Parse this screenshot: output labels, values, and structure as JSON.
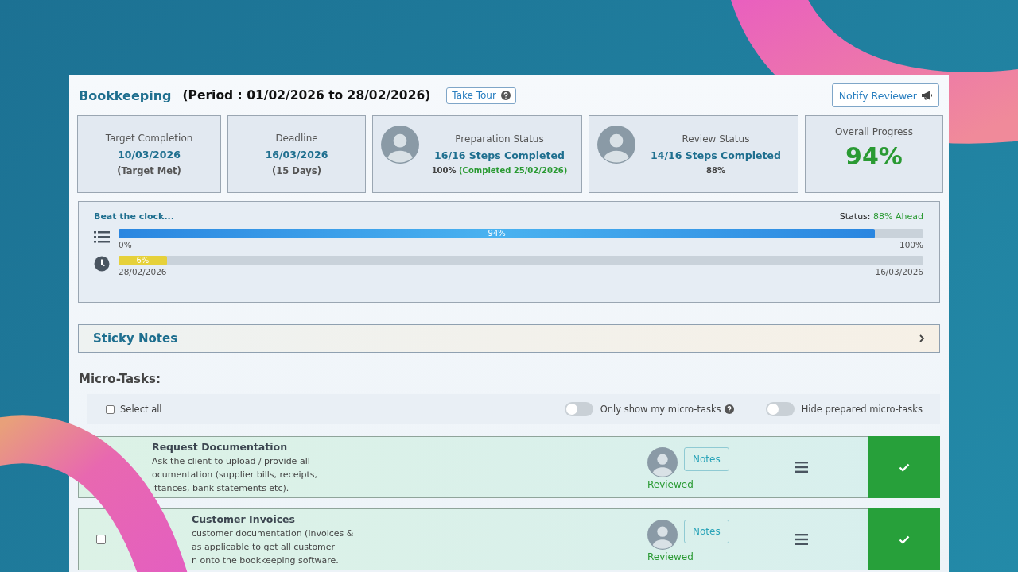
{
  "header": {
    "title": "Bookkeeping",
    "period": "(Period : 01/02/2026 to 28/02/2026)",
    "tour_button": "Take Tour",
    "notify_button": "Notify Reviewer"
  },
  "stats": [
    {
      "kind": "plain",
      "label": "Target Completion",
      "value": "10/03/2026",
      "note": "(Target Met)"
    },
    {
      "kind": "plain",
      "label": "Deadline",
      "value": "16/03/2026",
      "note": "(15 Days)"
    },
    {
      "kind": "avatar",
      "label": "Preparation Status",
      "value": "16/16 Steps Completed",
      "note": "100%",
      "note_extra": "(Completed 25/02/2026)"
    },
    {
      "kind": "avatar",
      "label": "Review Status",
      "value": "14/16 Steps Completed",
      "note": "88%"
    },
    {
      "kind": "big",
      "label": "Overall Progress",
      "value": "94%"
    }
  ],
  "clock": {
    "title": "Beat the clock...",
    "status_label": "Status:",
    "status_value": "88% Ahead",
    "bars": [
      {
        "kind": "progress",
        "label": "94%",
        "level": 0.94,
        "start": "0%",
        "end": "100%"
      },
      {
        "kind": "time",
        "label": "6%",
        "level": 0.06,
        "start": "28/02/2026",
        "end": "16/03/2026"
      }
    ]
  },
  "sticky_notes": {
    "title": "Sticky Notes",
    "expanded": false
  },
  "micro_tasks": {
    "title": "Micro-Tasks:",
    "select_all": {
      "label": "Select all",
      "checked": false
    },
    "toggles": [
      {
        "label": "Only show my micro-tasks",
        "on": false,
        "help": true
      },
      {
        "label": "Hide prepared micro-tasks",
        "on": false,
        "help": false
      }
    ],
    "tasks": [
      {
        "title": "Request Documentation",
        "description": [
          "Ask the client to upload / provide all",
          "ocumentation (supplier bills, receipts,",
          "ittances, bank statements etc)."
        ],
        "notes_button": "Notes",
        "status": "Reviewed",
        "done": true
      },
      {
        "title": "Customer Invoices",
        "description": [
          "customer documentation (invoices &",
          "as applicable to get all customer",
          "n onto the bookkeeping software."
        ],
        "checked": false,
        "notes_button": "Notes",
        "status": "Reviewed",
        "done": true
      }
    ]
  }
}
